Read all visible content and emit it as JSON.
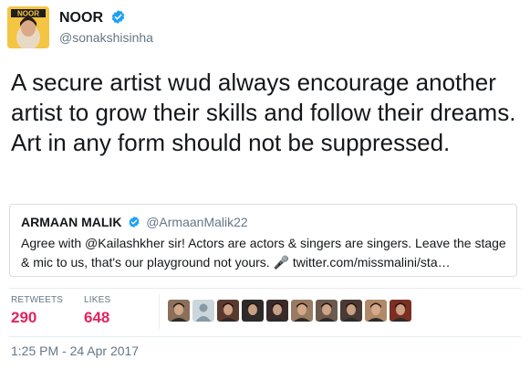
{
  "author": {
    "display_name": "NOOR",
    "handle": "@sonakshisinha",
    "avatar_text": "NOOR",
    "verified": true
  },
  "tweet": {
    "text": "A secure artist wud always encourage another artist to grow their skills and follow their dreams. Art in any form should not be suppressed."
  },
  "quoted": {
    "name": "ARMAAN MALIK",
    "handle": "@ArmaanMalik22",
    "text": "Agree with @Kailashkher sir! Actors are actors & singers are singers. Leave the stage & mic to us, that's our playground not yours. 🎤 twitter.com/missmalini/sta…"
  },
  "stats": {
    "retweets_label": "RETWEETS",
    "retweets_value": "290",
    "likes_label": "LIKES",
    "likes_value": "648"
  },
  "likers": [
    {
      "name": "liker-avatar-1",
      "bg": "#8b6f5a"
    },
    {
      "name": "liker-avatar-2",
      "bg": "#ccd6dd"
    },
    {
      "name": "liker-avatar-3",
      "bg": "#5b3a2e"
    },
    {
      "name": "liker-avatar-4",
      "bg": "#2f2a2a"
    },
    {
      "name": "liker-avatar-5",
      "bg": "#3a2b2b"
    },
    {
      "name": "liker-avatar-6",
      "bg": "#9a7b62"
    },
    {
      "name": "liker-avatar-7",
      "bg": "#6e5a4c"
    },
    {
      "name": "liker-avatar-8",
      "bg": "#4a3a34"
    },
    {
      "name": "liker-avatar-9",
      "bg": "#b08a68"
    },
    {
      "name": "liker-avatar-10",
      "bg": "#7a2f22"
    }
  ],
  "timestamp": "1:25 PM - 24 Apr 2017",
  "colors": {
    "verified": "#1da1f2",
    "like_count": "#e0245e",
    "muted": "#657786"
  }
}
